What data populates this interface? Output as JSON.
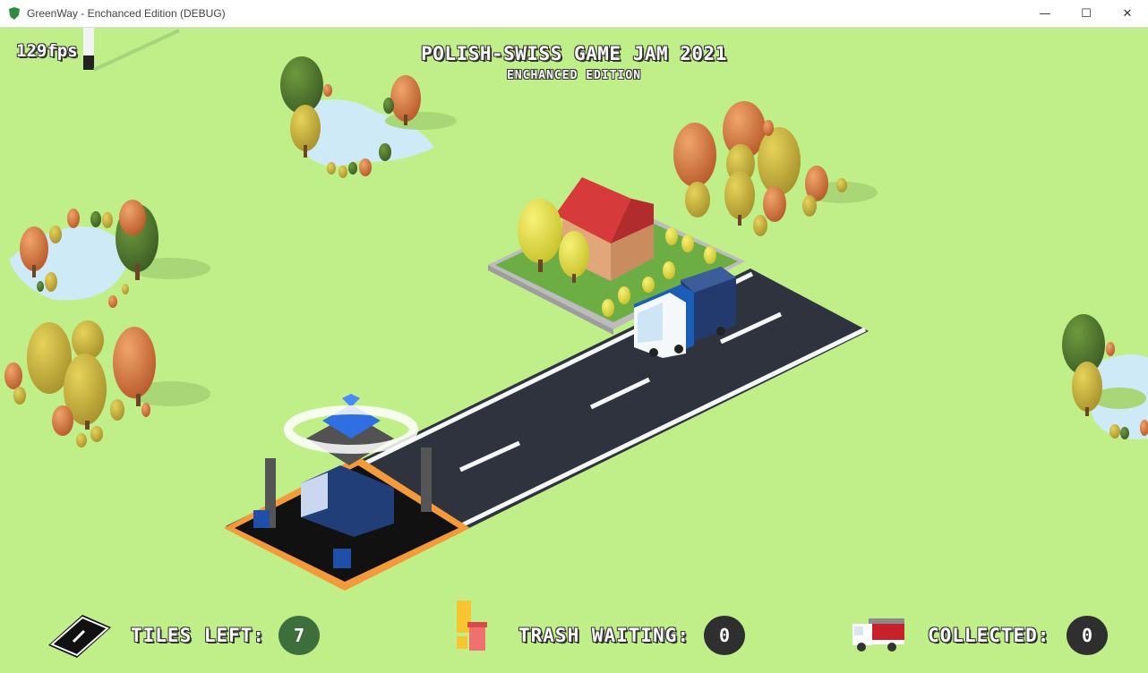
{
  "window": {
    "title": "GreenWay - Enchanced Edition (DEBUG)",
    "minimize_glyph": "—",
    "maximize_glyph": "☐",
    "close_glyph": "✕"
  },
  "hud": {
    "fps": "129fps",
    "game_title": "POLISH-SWISS GAME JAM 2021",
    "game_subtitle": "ENCHANCED EDITION",
    "tiles_left_label": "TILES LEFT:",
    "tiles_left_value": "7",
    "trash_waiting_label": "TRASH WAITING:",
    "trash_waiting_value": "0",
    "collected_label": "COLLECTED:",
    "collected_value": "0",
    "tiles_counter_color": "#3e6e3c",
    "dark_counter_color": "#2f2f2f"
  },
  "icons": {
    "tiles": "road-tile-icon",
    "trash": "trash-bin-icon",
    "collected": "garbage-truck-icon"
  },
  "colors": {
    "grass": "#c0ee88",
    "road": "#2f333d",
    "water": "#cfeaf7"
  }
}
